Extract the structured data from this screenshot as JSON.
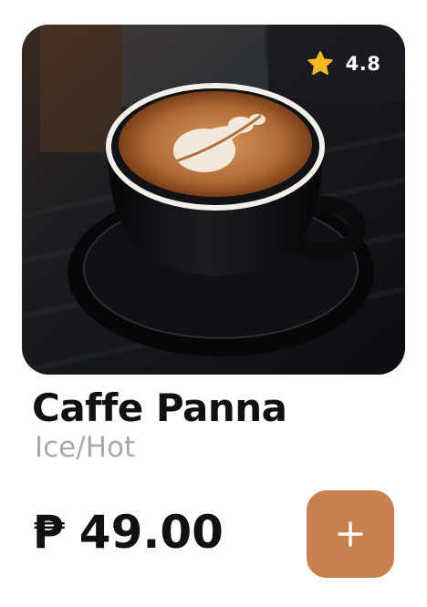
{
  "product": {
    "name": "Caffe Panna",
    "variant": "Ice/Hot",
    "rating": "4.8",
    "currency_symbol": "₱",
    "price": "49.00",
    "image_icon": "latte-art-coffee-cup-photo"
  },
  "actions": {
    "add_icon": "plus-icon"
  },
  "colors": {
    "add_button": "#c8804f",
    "star": "#f6b820",
    "name_text": "#111111",
    "variant_text": "#a9a9a9"
  }
}
